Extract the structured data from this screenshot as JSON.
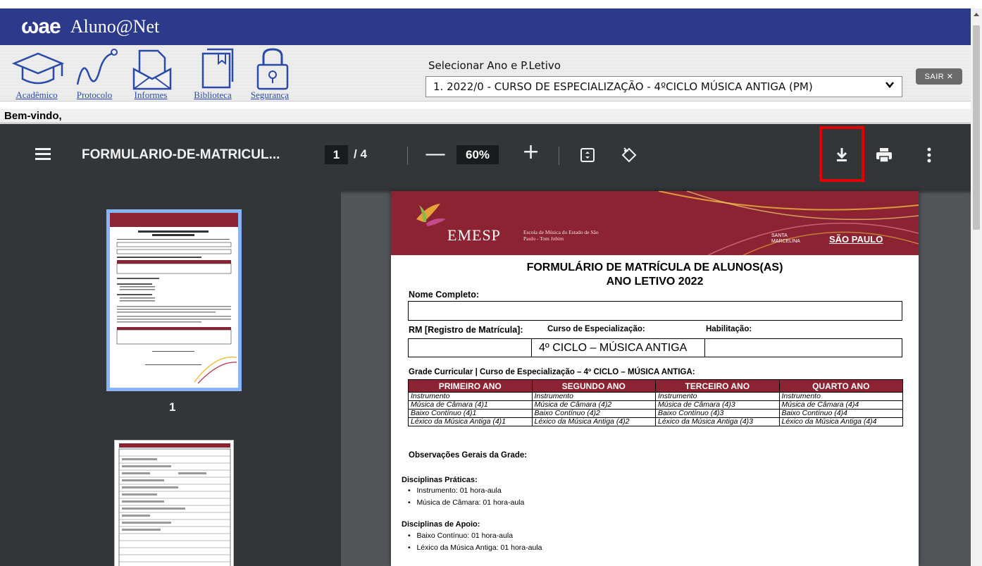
{
  "app": {
    "logo": "ωae",
    "title": "Aluno@Net"
  },
  "nav": {
    "items": [
      {
        "label": "Acadêmico"
      },
      {
        "label": "Protocolo"
      },
      {
        "label": "Informes"
      },
      {
        "label": "Biblioteca"
      },
      {
        "label": "Segurança"
      }
    ]
  },
  "selector": {
    "title": "Selecionar Ano e P.Letivo",
    "value": "1. 2022/0 - CURSO DE ESPECIALIZAÇÃO - 4ºCICLO MÚSICA ANTIGA (PM)"
  },
  "logout": {
    "label": "SAIR ✕"
  },
  "welcome": "Bem-vindo,",
  "pdf_toolbar": {
    "filename": "FORMULARIO-DE-MATRICUL...",
    "page": "1",
    "total": "/ 4",
    "zoom": "60%",
    "icons": [
      "menu-icon",
      "zoom-out-icon",
      "zoom-in-icon",
      "fit-page-icon",
      "rotate-icon",
      "download-icon",
      "print-icon",
      "more-icon"
    ]
  },
  "thumbnails": {
    "page_number": "1"
  },
  "document": {
    "header_school": "Escola de Música do Estado de São Paulo - Tom Jobim",
    "brand": "EMESP",
    "partner1": "SANTA MARCELINA",
    "partner2": "SÃO PAULO",
    "title_line1": "FORMULÁRIO DE MATRÍCULA DE ALUNOS(AS)",
    "title_line2": "ANO LETIVO 2022",
    "nome_label": "Nome Completo:",
    "rm_label": "RM [Registro de Matrícula]:",
    "curso_label": "Curso de Especialização:",
    "habilitacao_label": "Habilitação:",
    "curso_value": "4º CICLO – MÚSICA ANTIGA",
    "grade_label": "Grade Curricular | Curso de Especialização – 4º CICLO – MÚSICA ANTIGA:",
    "grade_headers": [
      "PRIMEIRO ANO",
      "SEGUNDO ANO",
      "TERCEIRO ANO",
      "QUARTO ANO"
    ],
    "grade_rows": [
      [
        "Instrumento",
        "Instrumento",
        "Instrumento",
        "Instrumento"
      ],
      [
        "Música de Câmara (4)1",
        "Música de Câmara (4)2",
        "Música de Câmara (4)3",
        "Música de Câmara (4)4"
      ],
      [
        "Baixo Contínuo (4)1",
        "Baixo Contínuo (4)2",
        "Baixo Contínuo (4)3",
        "Baixo Contínuo (4)4"
      ],
      [
        "Léxico da Música Antiga (4)1",
        "Léxico da Música Antiga (4)2",
        "Léxico da Música Antiga (4)3",
        "Léxico da Música Antiga (4)4"
      ]
    ],
    "obs_label": "Observações Gerais da Grade:",
    "praticas_label": "Disciplinas Práticas:",
    "praticas": [
      "Instrumento: 01 hora-aula",
      "Música de Câmara: 01 hora-aula"
    ],
    "apoio_label": "Disciplinas de Apoio:",
    "apoio": [
      "Baixo Contínuo: 01 hora-aula",
      "Léxico da Música Antiga: 01 hora-aula"
    ]
  },
  "colors": {
    "brand_bar": "#2c3a8c",
    "pdf_toolbar": "#323639",
    "pdf_background": "#525659",
    "doc_accent": "#8c2333",
    "highlight": "#e00000",
    "thumb_selected": "#8ab4f8"
  }
}
